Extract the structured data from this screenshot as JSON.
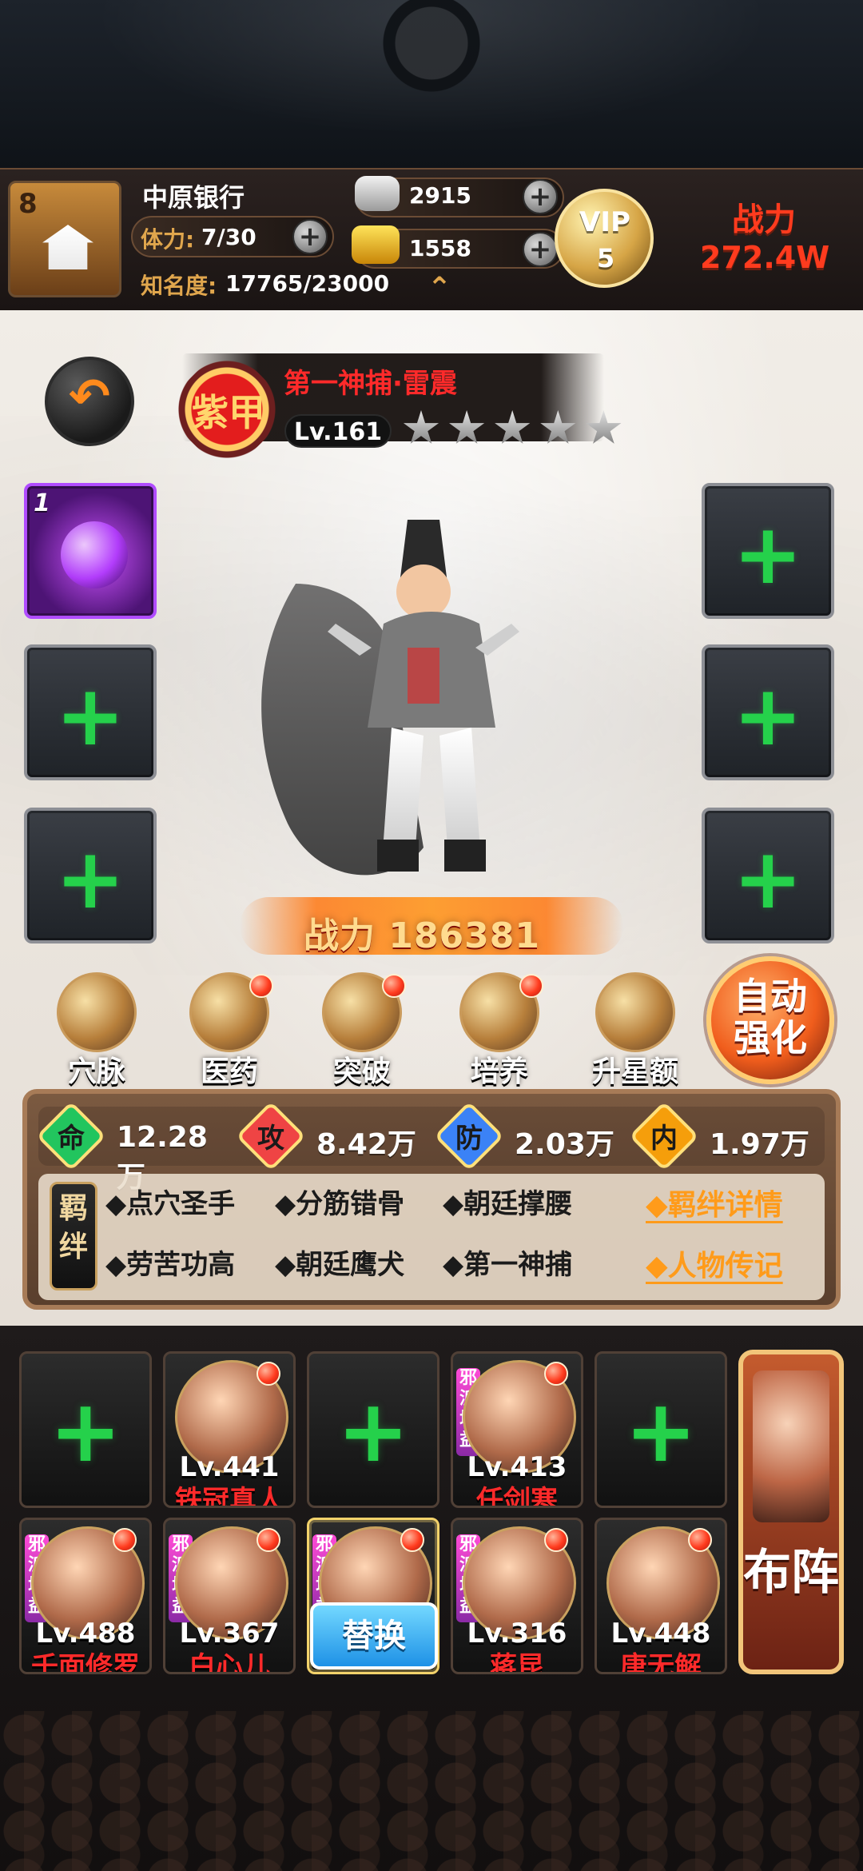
{
  "header": {
    "level_badge": "8",
    "location": "中原银行",
    "stamina_label": "体力:",
    "stamina_value": "7/30",
    "fame_label": "知名度:",
    "fame_value": "17765/23000",
    "silver_value": "2915",
    "gold_value": "1558",
    "vip_label": "VIP",
    "vip_level": "5",
    "combat_label": "战力",
    "combat_value": "272.4W"
  },
  "hero": {
    "title": "第一神捕·雷震",
    "seal_text": "紫甲",
    "level": "Lv.161",
    "stars": 5,
    "power_label": "战力",
    "power_value": "186381"
  },
  "actions": [
    {
      "label": "穴脉",
      "has_red_dot": false
    },
    {
      "label": "医药",
      "has_red_dot": true
    },
    {
      "label": "突破",
      "has_red_dot": true
    },
    {
      "label": "培养",
      "has_red_dot": true
    },
    {
      "label": "升星额外",
      "has_red_dot": false
    }
  ],
  "auto_strengthen": {
    "line1": "自动",
    "line2": "强化"
  },
  "stats": [
    {
      "key": "命",
      "value": "12.28万",
      "color": "#22c55e"
    },
    {
      "key": "攻",
      "value": "8.42万",
      "color": "#ef4444"
    },
    {
      "key": "防",
      "value": "2.03万",
      "color": "#3b82f6"
    },
    {
      "key": "内",
      "value": "1.97万",
      "color": "#f59e0b"
    }
  ],
  "bonds": {
    "seal": "羁绊",
    "items": [
      "◆点穴圣手",
      "◆分筋错骨",
      "◆朝廷撑腰",
      "◆劳苦功高",
      "◆朝廷鹰犬",
      "◆第一神捕"
    ],
    "links": [
      "◆羁绊详情",
      "◆人物传记"
    ]
  },
  "team": {
    "row1": [
      {
        "type": "empty"
      },
      {
        "type": "hero",
        "level": "Lv.441",
        "name": "铁冠真人",
        "badge": ""
      },
      {
        "type": "empty"
      },
      {
        "type": "hero",
        "level": "Lv.413",
        "name": "任剑寒",
        "badge": "邪派增益"
      },
      {
        "type": "empty"
      }
    ],
    "row2": [
      {
        "type": "hero",
        "level": "Lv.488",
        "name": "千面修罗",
        "badge": "邪派增益"
      },
      {
        "type": "hero",
        "level": "Lv.367",
        "name": "白心儿",
        "badge": "邪派增益"
      },
      {
        "type": "selected",
        "badge": "邪派增益",
        "button": "替换"
      },
      {
        "type": "hero",
        "level": "Lv.316",
        "name": "蒋昆",
        "badge": "邪派增益"
      },
      {
        "type": "hero",
        "level": "Lv.448",
        "name": "唐无解",
        "badge": ""
      }
    ],
    "formation_text": "布阵"
  },
  "colors": {
    "accent_orange": "#ff9b1a",
    "hero_title_red": "#ff2a2a",
    "green_plus": "#25d14b"
  }
}
